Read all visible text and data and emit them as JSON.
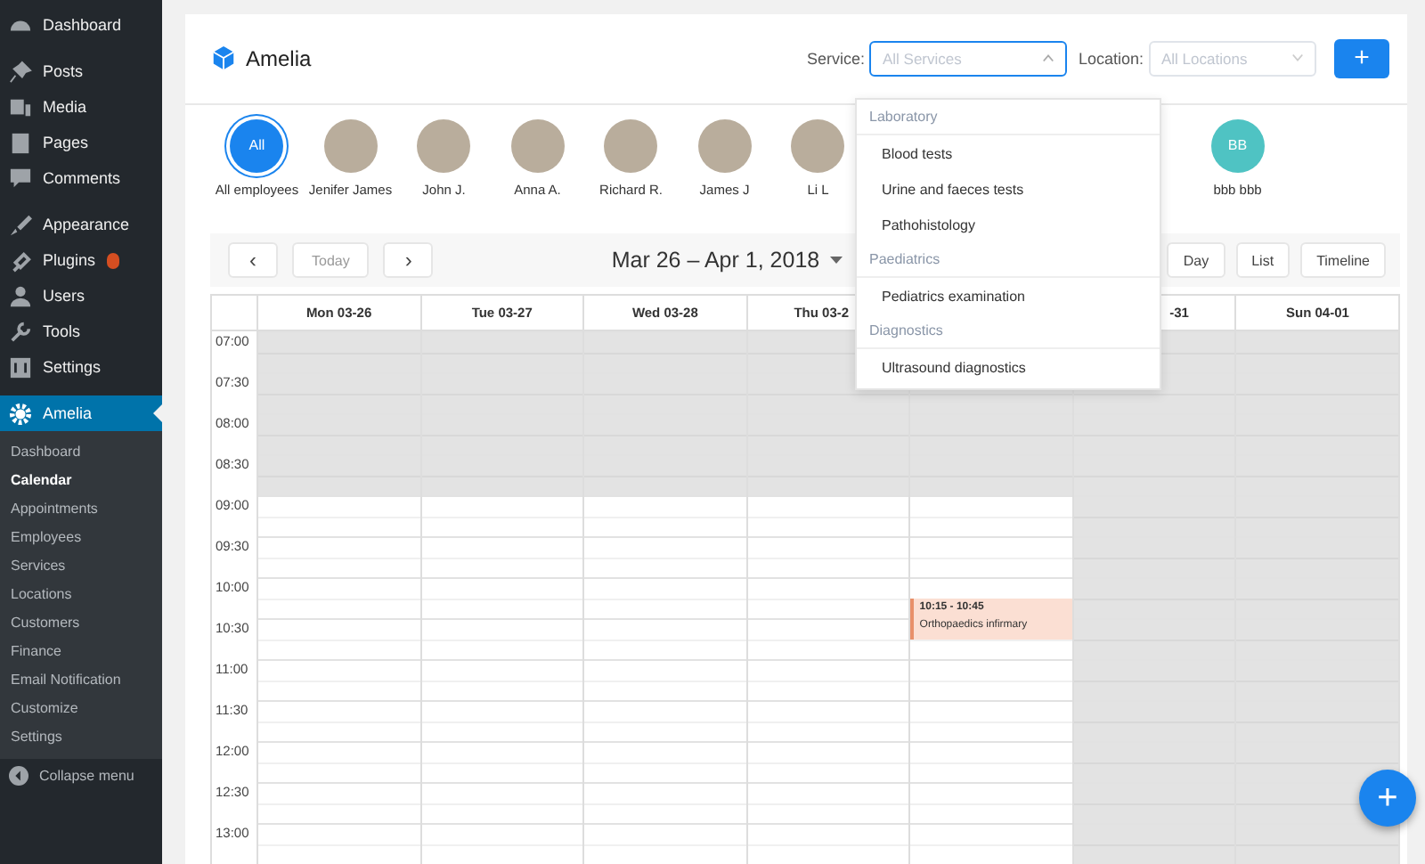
{
  "sidebar": {
    "items": [
      {
        "label": "Dashboard",
        "selected": false,
        "badge": false
      },
      {
        "label": "Posts",
        "selected": false,
        "badge": false
      },
      {
        "label": "Media",
        "selected": false,
        "badge": false
      },
      {
        "label": "Pages",
        "selected": false,
        "badge": false
      },
      {
        "label": "Comments",
        "selected": false,
        "badge": false
      },
      {
        "label": "Appearance",
        "selected": false,
        "badge": false
      },
      {
        "label": "Plugins",
        "selected": false,
        "badge": true
      },
      {
        "label": "Users",
        "selected": false,
        "badge": false
      },
      {
        "label": "Tools",
        "selected": false,
        "badge": false
      },
      {
        "label": "Settings",
        "selected": false,
        "badge": false
      },
      {
        "label": "Amelia",
        "selected": true,
        "badge": false,
        "children": [
          {
            "label": "Dashboard",
            "selected": false
          },
          {
            "label": "Calendar",
            "selected": true
          },
          {
            "label": "Appointments",
            "selected": false
          },
          {
            "label": "Employees",
            "selected": false
          },
          {
            "label": "Services",
            "selected": false
          },
          {
            "label": "Locations",
            "selected": false
          },
          {
            "label": "Customers",
            "selected": false
          },
          {
            "label": "Finance",
            "selected": false
          },
          {
            "label": "Email Notification",
            "selected": false
          },
          {
            "label": "Customize",
            "selected": false
          },
          {
            "label": "Settings",
            "selected": false
          }
        ]
      }
    ],
    "collapse": "Collapse menu"
  },
  "header": {
    "app_name": "Amelia",
    "service_label": "Service:",
    "service_placeholder": "All Services",
    "service_focused": true,
    "location_label": "Location:",
    "location_placeholder": "All Locations",
    "add_button": "+"
  },
  "employees": [
    {
      "name": "All employees",
      "kind": "all",
      "initials": "All",
      "selected": true
    },
    {
      "name": "Jenifer James",
      "kind": "photo",
      "selected": false
    },
    {
      "name": "John J.",
      "kind": "photo",
      "selected": false
    },
    {
      "name": "Anna A.",
      "kind": "photo",
      "selected": false
    },
    {
      "name": "Richard R.",
      "kind": "photo",
      "selected": false
    },
    {
      "name": "James J",
      "kind": "photo",
      "selected": false
    },
    {
      "name": "Li L",
      "kind": "photo",
      "selected": false
    },
    {
      "name": "bbb bbb",
      "kind": "initials",
      "initials": "BB",
      "selected": false,
      "color": "#4fc3c3"
    }
  ],
  "service_dropdown": {
    "groups": [
      {
        "label": "Laboratory",
        "items": [
          "Blood tests",
          "Urine and faeces tests",
          "Pathohistology"
        ]
      },
      {
        "label": "Paediatrics",
        "items": [
          "Pediatrics examination"
        ]
      },
      {
        "label": "Diagnostics",
        "items": [
          "Ultrasound diagnostics"
        ]
      }
    ]
  },
  "toolbar": {
    "prev": "‹",
    "today": "Today",
    "next": "›",
    "range": "Mar 26 – Apr 1, 2018",
    "views": [
      {
        "label": "Day",
        "selected": false
      },
      {
        "label": "List",
        "selected": false
      },
      {
        "label": "Timeline",
        "selected": false
      }
    ]
  },
  "calendar": {
    "days": [
      {
        "label": "Mon 03-26",
        "kind": "full",
        "working": true
      },
      {
        "label": "Tue 03-27",
        "kind": "full",
        "working": true
      },
      {
        "label": "Wed 03-28",
        "kind": "full",
        "working": true
      },
      {
        "label": "Thu 03-2",
        "kind": "cut_end",
        "working": true
      },
      {
        "working": true,
        "events": [
          {
            "time": "10:15 - 10:45",
            "title": "Orthopaedics infirmary"
          }
        ]
      },
      {
        "label": "-31",
        "kind": "cut_start",
        "working": false
      },
      {
        "label": "Sun 04-01",
        "kind": "full",
        "working": false
      }
    ],
    "slots": [
      {
        "time": "07:00",
        "working": false
      },
      {
        "time": "07:30",
        "working": false
      },
      {
        "time": "08:00",
        "working": false
      },
      {
        "time": "08:30",
        "working": false
      },
      {
        "time": "09:00",
        "working": true
      },
      {
        "time": "09:30",
        "working": true
      },
      {
        "time": "10:00",
        "working": true
      },
      {
        "time": "10:30",
        "working": true
      },
      {
        "time": "11:00",
        "working": true
      },
      {
        "time": "11:30",
        "working": true
      },
      {
        "time": "12:00",
        "working": true
      },
      {
        "time": "12:30",
        "working": true
      },
      {
        "time": "13:00",
        "working": true
      }
    ]
  },
  "fab": "+"
}
